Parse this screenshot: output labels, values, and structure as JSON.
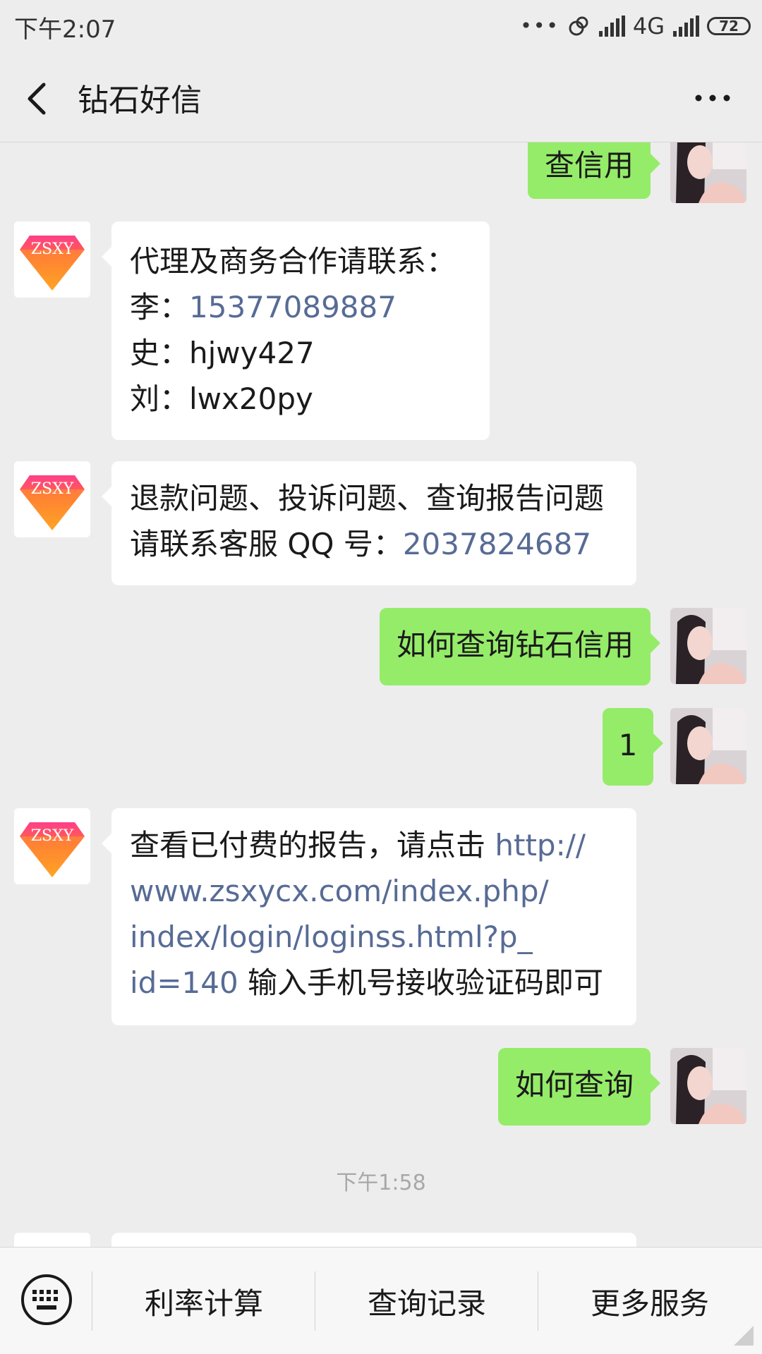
{
  "status_bar": {
    "time": "下午2:07",
    "network": "4G",
    "battery": "72"
  },
  "nav": {
    "title": "钻石好信"
  },
  "messages": {
    "m0": {
      "text": "查信用"
    },
    "m1": {
      "line1": "代理及商务合作请联系：",
      "line2_label": "李：",
      "line2_phone": "15377089887",
      "line3": "史：hjwy427",
      "line4": "刘：lwx20py"
    },
    "m2": {
      "line1": "退款问题、投诉问题、查询报告问题",
      "line2_label": "请联系客服 QQ 号：",
      "line2_qq": "2037824687"
    },
    "m3": {
      "text": "如何查询钻石信用"
    },
    "m4": {
      "text": "1"
    },
    "m5": {
      "prefix": "查看已付费的报告，请点击 ",
      "link_line1": "http://",
      "link_line2": "www.zsxycx.com/index.php/",
      "link_line3": "index/login/loginss.html?p_",
      "link_line4": "id=140",
      "suffix": " 输入手机号接收验证码即可"
    },
    "m6": {
      "text": "如何查询"
    },
    "timestamp": "下午1:58"
  },
  "bottom_menu": {
    "item1": "利率计算",
    "item2": "查询记录",
    "item3": "更多服务"
  },
  "logo_text": "ZSXY",
  "colors": {
    "background": "#ededed",
    "sent_bubble": "#95ec69",
    "received_bubble": "#ffffff",
    "link": "#576b95"
  }
}
